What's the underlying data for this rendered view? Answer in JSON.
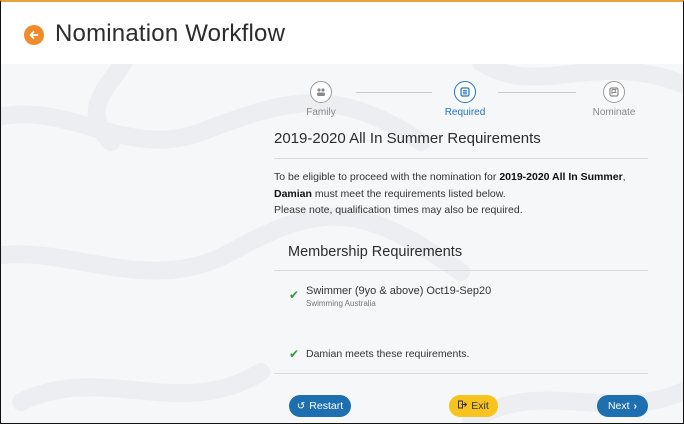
{
  "header": {
    "title": "Nomination Workflow",
    "back_icon": "arrow-left-icon",
    "accent": "#f08a2b"
  },
  "stepper": {
    "steps": [
      {
        "label": "Family",
        "icon": "family-icon",
        "state": "done"
      },
      {
        "label": "Required",
        "icon": "list-icon",
        "state": "active"
      },
      {
        "label": "Nominate",
        "icon": "flag-icon",
        "state": "pending"
      }
    ]
  },
  "main": {
    "title": "2019-2020 All In Summer Requirements",
    "intro_prefix": "To be eligible to proceed with the nomination for ",
    "intro_event": "2019-2020 All In Summer",
    "intro_comma": ",",
    "intro_person": "Damian",
    "intro_suffix": " must meet the requirements listed below.",
    "intro_note": "Please note, qualification times may also be required.",
    "section_title": "Membership Requirements",
    "requirements": [
      {
        "name": "Swimmer (9yo & above) Oct19-Sep20",
        "org": "Swimming Australia",
        "met": true
      }
    ],
    "summary": "Damian meets these requirements."
  },
  "actions": {
    "restart_label": "Restart",
    "exit_label": "Exit",
    "next_label": "Next",
    "primary_color": "#1e6fb0",
    "exit_color": "#f7c31f"
  }
}
